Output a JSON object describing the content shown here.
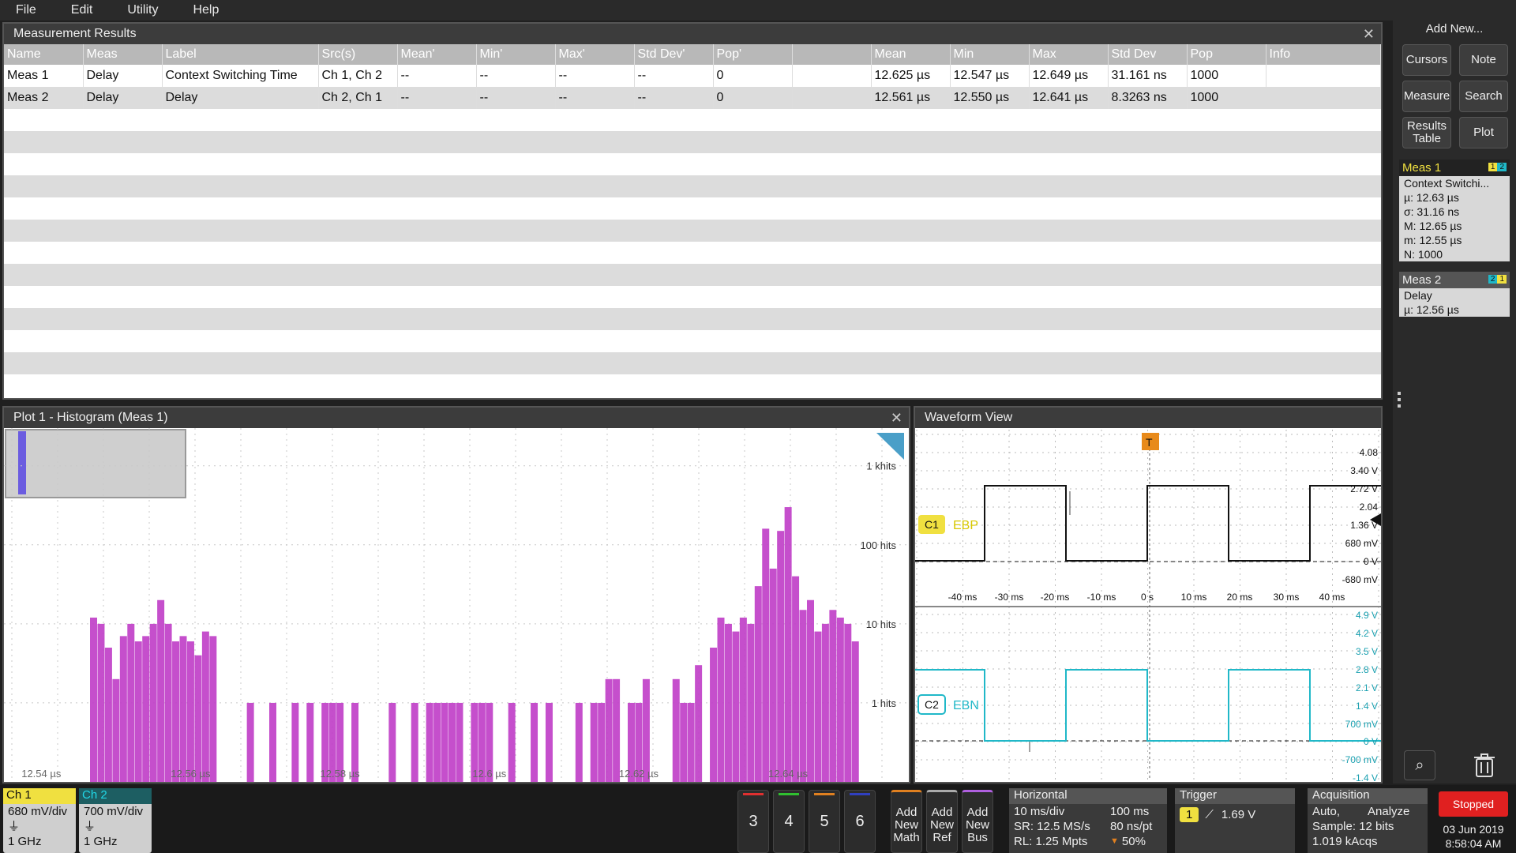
{
  "menu": [
    "File",
    "Edit",
    "Utility",
    "Help"
  ],
  "meas_panel": {
    "title": "Measurement Results",
    "headers": [
      "Name",
      "Meas",
      "Label",
      "Src(s)",
      "Mean'",
      "Min'",
      "Max'",
      "Std Dev'",
      "Pop'",
      "",
      "Mean",
      "Min",
      "Max",
      "Std Dev",
      "Pop",
      "Info"
    ],
    "rows": [
      [
        "Meas 1",
        "Delay",
        "Context Switching Time",
        "Ch 1, Ch 2",
        "--",
        "--",
        "--",
        "--",
        "0",
        "",
        "12.625 µs",
        "12.547 µs",
        "12.649 µs",
        "31.161 ns",
        "1000",
        ""
      ],
      [
        "Meas 2",
        "Delay",
        "Delay",
        "Ch 2, Ch 1",
        "--",
        "--",
        "--",
        "--",
        "0",
        "",
        "12.561 µs",
        "12.550 µs",
        "12.641 µs",
        "8.3263 ns",
        "1000",
        ""
      ]
    ]
  },
  "plot_panel": {
    "title": "Plot 1 - Histogram (Meas 1)",
    "y_labels": [
      "1 khits",
      "100 hits",
      "10 hits",
      "1 hits"
    ],
    "x_labels": [
      "12.54 µs",
      "12.56 µs",
      "12.58 µs",
      "12.6 µs",
      "12.62 µs",
      "12.64 µs"
    ]
  },
  "chart_data": {
    "type": "bar",
    "title": "Plot 1 - Histogram (Meas 1)",
    "xlabel": "",
    "ylabel": "",
    "y_scale": "log",
    "ylim_hits": [
      0.1,
      3000
    ],
    "xlim_us": [
      12.535,
      12.655
    ],
    "bins_us": [
      12.547,
      12.548,
      12.549,
      12.55,
      12.551,
      12.552,
      12.553,
      12.554,
      12.555,
      12.556,
      12.557,
      12.558,
      12.559,
      12.56,
      12.561,
      12.562,
      12.563,
      12.568,
      12.571,
      12.574,
      12.576,
      12.578,
      12.579,
      12.58,
      12.582,
      12.587,
      12.59,
      12.592,
      12.593,
      12.594,
      12.595,
      12.596,
      12.598,
      12.599,
      12.6,
      12.603,
      12.606,
      12.608,
      12.612,
      12.614,
      12.615,
      12.616,
      12.617,
      12.619,
      12.62,
      12.621,
      12.625,
      12.626,
      12.627,
      12.628,
      12.63,
      12.631,
      12.632,
      12.633,
      12.634,
      12.635,
      12.636,
      12.637,
      12.638,
      12.639,
      12.64,
      12.641,
      12.642,
      12.643,
      12.644,
      12.645,
      12.646,
      12.647,
      12.648,
      12.649
    ],
    "hits": [
      12,
      10,
      5,
      2,
      7,
      10,
      6,
      7,
      10,
      20,
      10,
      6,
      7,
      6,
      4,
      8,
      7,
      1,
      1,
      1,
      1,
      1,
      1,
      1,
      1,
      1,
      1,
      1,
      1,
      1,
      1,
      1,
      1,
      1,
      1,
      1,
      1,
      1,
      1,
      1,
      1,
      2,
      2,
      1,
      1,
      2,
      2,
      1,
      1,
      3,
      5,
      12,
      10,
      8,
      12,
      10,
      30,
      160,
      50,
      150,
      300,
      40,
      15,
      20,
      8,
      10,
      15,
      12,
      10,
      6
    ]
  },
  "wave_panel": {
    "title": "Waveform View",
    "c1_label": "C1",
    "c1_name": "EBP",
    "c2_label": "C2",
    "c2_name": "EBN",
    "c1_volts": [
      "4.08",
      "3.40 V",
      "2.72 V",
      "2.04",
      "1.36 V",
      "680 mV",
      "0 V",
      "-680 mV"
    ],
    "time_ticks": [
      "-40 ms",
      "-30 ms",
      "-20 ms",
      "-10 ms",
      "0 s",
      "10 ms",
      "20 ms",
      "30 ms",
      "40 ms"
    ],
    "c2_volts": [
      "4.9 V",
      "4.2 V",
      "3.5 V",
      "2.8 V",
      "2.1 V",
      "1.4 V",
      "700 mV",
      "0 V",
      "-700 mV",
      "-1.4 V"
    ],
    "trigger_marker": "T",
    "c1_color": "#f0e040",
    "c2_color": "#20b8c8"
  },
  "side": {
    "add_new": "Add New...",
    "buttons": [
      "Cursors",
      "Note",
      "Measure",
      "Search",
      "Results Table",
      "Plot"
    ],
    "meas1": {
      "title": "Meas 1",
      "src_a": "1",
      "src_b": "2",
      "label": "Context Switchi...",
      "lines": [
        "µ:  12.63 µs",
        "σ:  31.16 ns",
        "M: 12.65 µs",
        "m: 12.55 µs",
        "N: 1000"
      ]
    },
    "meas2": {
      "title": "Meas 2",
      "src_a": "2",
      "src_b": "1",
      "label": "Delay",
      "lines": [
        "µ:  12.56 µs"
      ]
    }
  },
  "bottom": {
    "ch1": {
      "title": "Ch 1",
      "scale": "680 mV/div",
      "bw": "1 GHz",
      "color": "#f0e040"
    },
    "ch2": {
      "title": "Ch 2",
      "scale": "700 mV/div",
      "bw": "1 GHz",
      "color": "#20b8c8"
    },
    "num_buttons": [
      "3",
      "4",
      "5",
      "6"
    ],
    "add_math": "Add New Math",
    "add_ref": "Add New Ref",
    "add_bus": "Add New Bus",
    "horizontal": {
      "title": "Horizontal",
      "r1a": "10 ms/div",
      "r1b": "100 ms",
      "r2a": "SR: 12.5 MS/s",
      "r2b": "80 ns/pt",
      "r3a": "RL: 1.25 Mpts",
      "r3b": "50%"
    },
    "trigger": {
      "title": "Trigger",
      "source": "1",
      "level": "1.69 V"
    },
    "acquisition": {
      "title": "Acquisition",
      "r1a": "Auto,",
      "r1b": "Analyze",
      "r2": "Sample: 12 bits",
      "r3": "1.019 kAcqs"
    },
    "status": "Stopped",
    "date": "03 Jun 2019",
    "time": "8:58:04 AM"
  }
}
